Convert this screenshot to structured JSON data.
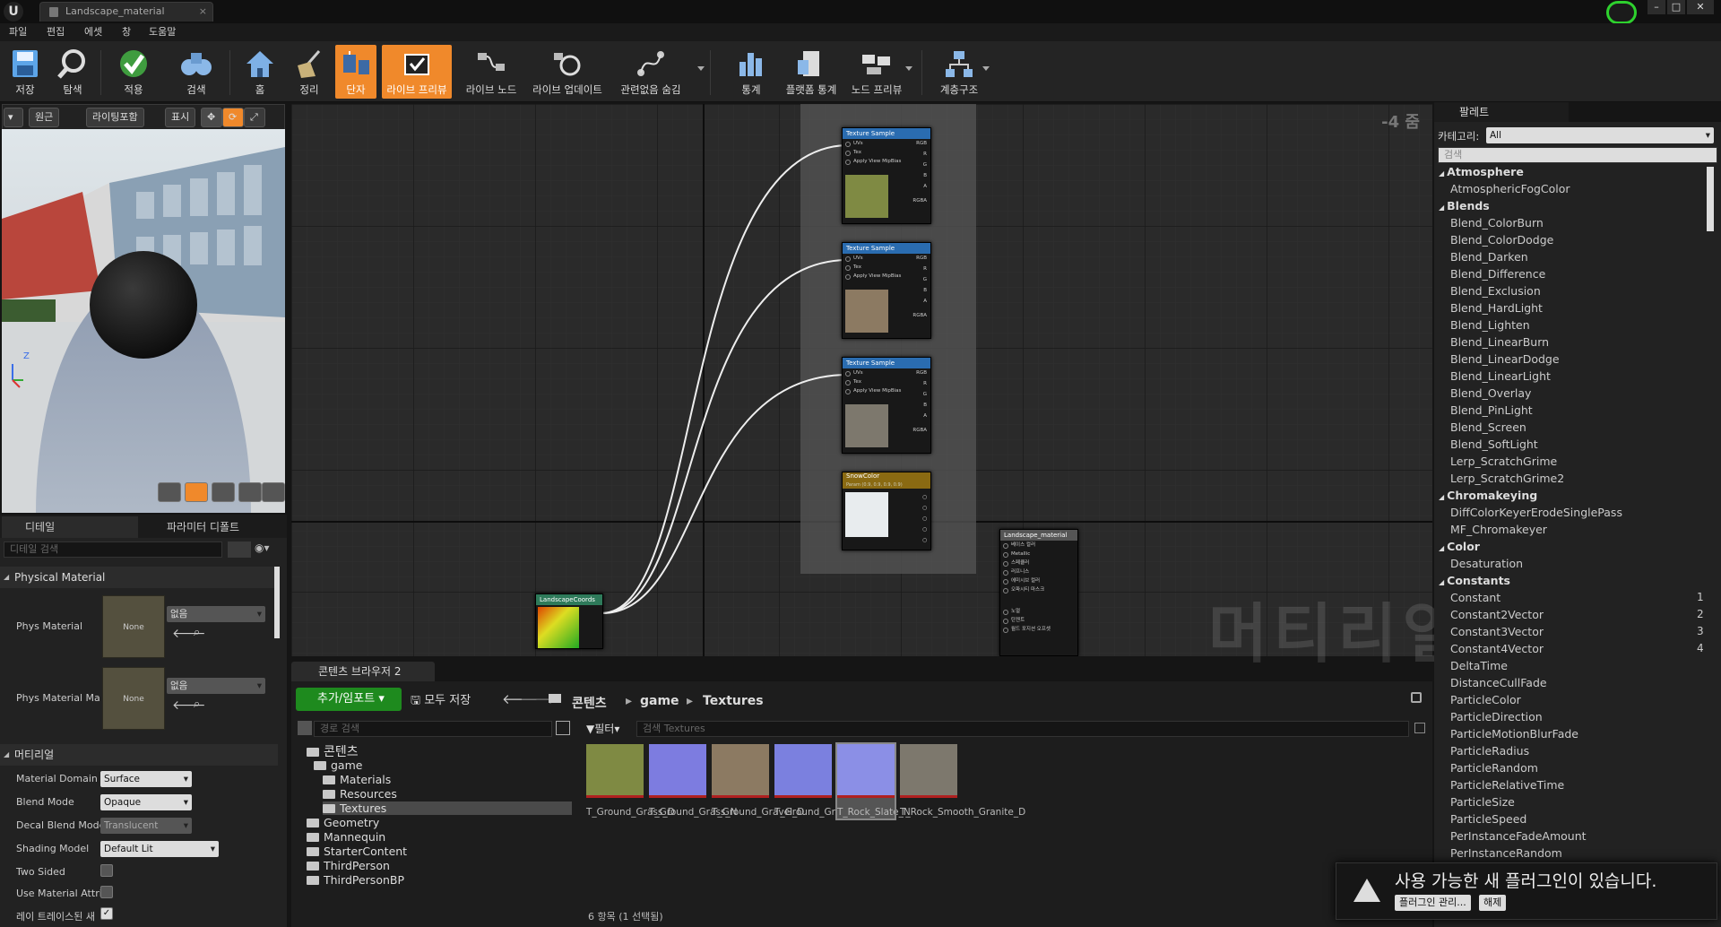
{
  "window": {
    "tab_title": "Landscape_material"
  },
  "menu": [
    "파일",
    "편집",
    "에셋",
    "창",
    "도움말"
  ],
  "toolbar": [
    {
      "label": "저장",
      "icon": "save-icon"
    },
    {
      "label": "탐색",
      "icon": "browse-icon"
    },
    {
      "label": "적용",
      "icon": "apply-icon"
    },
    {
      "label": "검색",
      "icon": "search-icon"
    },
    {
      "label": "홈",
      "icon": "home-icon"
    },
    {
      "label": "정리",
      "icon": "clean-icon"
    },
    {
      "label": "단자",
      "icon": "connectors-icon",
      "active": true
    },
    {
      "label": "라이브 프리뷰",
      "icon": "live-preview-icon",
      "active": true
    },
    {
      "label": "라이브 노드",
      "icon": "live-nodes-icon"
    },
    {
      "label": "라이브 업데이트",
      "icon": "live-update-icon"
    },
    {
      "label": "관련없음 숨김",
      "icon": "hide-unrelated-icon"
    },
    {
      "label": "통계",
      "icon": "stats-icon"
    },
    {
      "label": "플랫폼 통계",
      "icon": "platform-stats-icon"
    },
    {
      "label": "노드 프리뷰",
      "icon": "node-preview-icon"
    },
    {
      "label": "계층구조",
      "icon": "hierarchy-icon"
    }
  ],
  "viewport": {
    "perspective": "원근",
    "lighting": "라이팅포함",
    "show": "표시"
  },
  "details": {
    "tab_details": "디테일",
    "tab_params": "파라미터 디폴트",
    "search_placeholder": "디테일 검색",
    "cat_physical": "Physical Material",
    "phys_material": "Phys Material",
    "phys_material_map": "Phys Material Ma",
    "none": "None",
    "none_combo": "없음",
    "cat_material": "머티리얼",
    "props": [
      {
        "label": "Material Domain",
        "value": "Surface"
      },
      {
        "label": "Blend Mode",
        "value": "Opaque"
      },
      {
        "label": "Decal Blend Mode",
        "value": "Translucent"
      },
      {
        "label": "Shading Model",
        "value": "Default Lit"
      },
      {
        "label": "Two Sided",
        "value": ""
      },
      {
        "label": "Use Material Attri",
        "value": ""
      },
      {
        "label": "레이 트레이스된 새",
        "value": ""
      }
    ]
  },
  "graph": {
    "zoom": "-4 줌",
    "watermark": "머티리얼",
    "nodes": {
      "texture_sample": "Texture Sample",
      "snow": "SnowColor",
      "snow_sub": "Param (0.9, 0.9, 0.9, 0.9)",
      "coords": "LandscapeCoords",
      "result": "Landscape_material",
      "pin_uvs": "UVs",
      "pin_tex": "Tex",
      "pin_mip": "Apply View MipBias",
      "out_rgb": "RGB",
      "out_r": "R",
      "out_g": "G",
      "out_b": "B",
      "out_a": "A",
      "out_rgba": "RGBA",
      "result_pins": [
        "베이스 컬러",
        "Metallic",
        "스페큘러",
        "러프니스",
        "에미시브 컬러",
        "오파시티 마스크",
        "노멀",
        "탄젠트",
        "월드 포지션 오프셋"
      ]
    }
  },
  "content_browser": {
    "tab": "콘텐츠 브라우저 2",
    "add_import": "추가/임포트",
    "save_all": "모두 저장",
    "crumbs": [
      "콘텐츠",
      "game",
      "Textures"
    ],
    "path_search_placeholder": "경로 검색",
    "filter": "필터",
    "search_placeholder": "검색 Textures",
    "tree": [
      {
        "label": "콘텐츠",
        "indent": 0
      },
      {
        "label": "game",
        "indent": 1
      },
      {
        "label": "Materials",
        "indent": 2
      },
      {
        "label": "Resources",
        "indent": 2
      },
      {
        "label": "Textures",
        "indent": 2,
        "selected": true
      },
      {
        "label": "Geometry",
        "indent": 1
      },
      {
        "label": "Mannequin",
        "indent": 1
      },
      {
        "label": "StarterContent",
        "indent": 1
      },
      {
        "label": "ThirdPerson",
        "indent": 1
      },
      {
        "label": "ThirdPersonBP",
        "indent": 1
      }
    ],
    "assets": [
      {
        "name": "T_Ground_Grass_D",
        "color": "#7f8a43"
      },
      {
        "name": "T_Ground_Grass_N",
        "color": "#7d7ce0"
      },
      {
        "name": "T_Ground_Gravel_D",
        "color": "#8c7a62"
      },
      {
        "name": "T_Ground_Gravel_N",
        "color": "#7b80df"
      },
      {
        "name": "T_Rock_Slate_N",
        "color": "#8b8fe6"
      },
      {
        "name": "T_Rock_Smooth_Granite_D",
        "color": "#7d786d"
      }
    ],
    "status": "6 항목 (1 선택됨)"
  },
  "palette": {
    "tab": "팔레트",
    "category_label": "카테고리:",
    "category_value": "All",
    "search_placeholder": "검색",
    "entries": [
      {
        "t": "cat",
        "label": "Atmosphere"
      },
      {
        "t": "item",
        "label": "AtmosphericFogColor"
      },
      {
        "t": "cat",
        "label": "Blends"
      },
      {
        "t": "item",
        "label": "Blend_ColorBurn"
      },
      {
        "t": "item",
        "label": "Blend_ColorDodge"
      },
      {
        "t": "item",
        "label": "Blend_Darken"
      },
      {
        "t": "item",
        "label": "Blend_Difference"
      },
      {
        "t": "item",
        "label": "Blend_Exclusion"
      },
      {
        "t": "item",
        "label": "Blend_HardLight"
      },
      {
        "t": "item",
        "label": "Blend_Lighten"
      },
      {
        "t": "item",
        "label": "Blend_LinearBurn"
      },
      {
        "t": "item",
        "label": "Blend_LinearDodge"
      },
      {
        "t": "item",
        "label": "Blend_LinearLight"
      },
      {
        "t": "item",
        "label": "Blend_Overlay"
      },
      {
        "t": "item",
        "label": "Blend_PinLight"
      },
      {
        "t": "item",
        "label": "Blend_Screen"
      },
      {
        "t": "item",
        "label": "Blend_SoftLight"
      },
      {
        "t": "item",
        "label": "Lerp_ScratchGrime"
      },
      {
        "t": "item",
        "label": "Lerp_ScratchGrime2"
      },
      {
        "t": "cat",
        "label": "Chromakeying"
      },
      {
        "t": "item",
        "label": "DiffColorKeyerErodeSinglePass"
      },
      {
        "t": "item",
        "label": "MF_Chromakeyer"
      },
      {
        "t": "cat",
        "label": "Color"
      },
      {
        "t": "item",
        "label": "Desaturation"
      },
      {
        "t": "cat",
        "label": "Constants"
      },
      {
        "t": "item",
        "label": "Constant",
        "hotkey": "1"
      },
      {
        "t": "item",
        "label": "Constant2Vector",
        "hotkey": "2"
      },
      {
        "t": "item",
        "label": "Constant3Vector",
        "hotkey": "3"
      },
      {
        "t": "item",
        "label": "Constant4Vector",
        "hotkey": "4"
      },
      {
        "t": "item",
        "label": "DeltaTime"
      },
      {
        "t": "item",
        "label": "DistanceCullFade"
      },
      {
        "t": "item",
        "label": "ParticleColor"
      },
      {
        "t": "item",
        "label": "ParticleDirection"
      },
      {
        "t": "item",
        "label": "ParticleMotionBlurFade"
      },
      {
        "t": "item",
        "label": "ParticleRadius"
      },
      {
        "t": "item",
        "label": "ParticleRandom"
      },
      {
        "t": "item",
        "label": "ParticleRelativeTime"
      },
      {
        "t": "item",
        "label": "ParticleSize"
      },
      {
        "t": "item",
        "label": "ParticleSpeed"
      },
      {
        "t": "item",
        "label": "PerInstanceFadeAmount"
      },
      {
        "t": "item",
        "label": "PerInstanceRandom"
      }
    ]
  },
  "toast": {
    "message": "사용 가능한 새 플러그인이 있습니다.",
    "manage": "플러그인 관리...",
    "dismiss": "해제"
  }
}
